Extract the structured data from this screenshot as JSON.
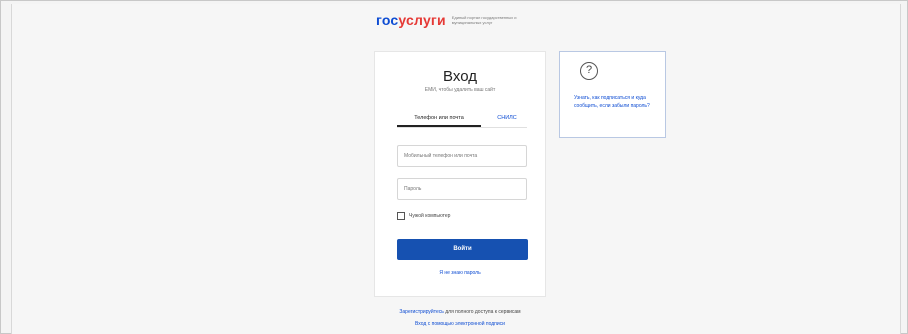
{
  "header": {
    "logo_gos": "гос",
    "logo_uslugi": "услуги",
    "logo_tagline": "Единый портал государственных и муниципальных услуг"
  },
  "login": {
    "title": "Вход",
    "subtitle": "ЕМИ, чтобы удалить ваш сайт",
    "tabs": [
      {
        "label": "Телефон или почта",
        "active": true
      },
      {
        "label": "СНИЛС",
        "active": false
      }
    ],
    "login_placeholder": "Мобильный телефон или почта",
    "password_placeholder": "Пароль",
    "remember_label": "Чужой компьютер",
    "submit_label": "Войти",
    "forgot_label": "Я не знаю пароль"
  },
  "help": {
    "icon": "question-circle-icon",
    "text": "Узнать, как подписаться и куда сообщить, если забыли пароль?"
  },
  "footer": {
    "register_link": "Зарегистрируйтесь",
    "register_suffix": "для полного доступа к сервисам",
    "esign_link": "Вход с помощью электронной подписи"
  },
  "colors": {
    "brand_blue": "#0d4cd3",
    "brand_red": "#e53935",
    "button": "#1651b1"
  }
}
